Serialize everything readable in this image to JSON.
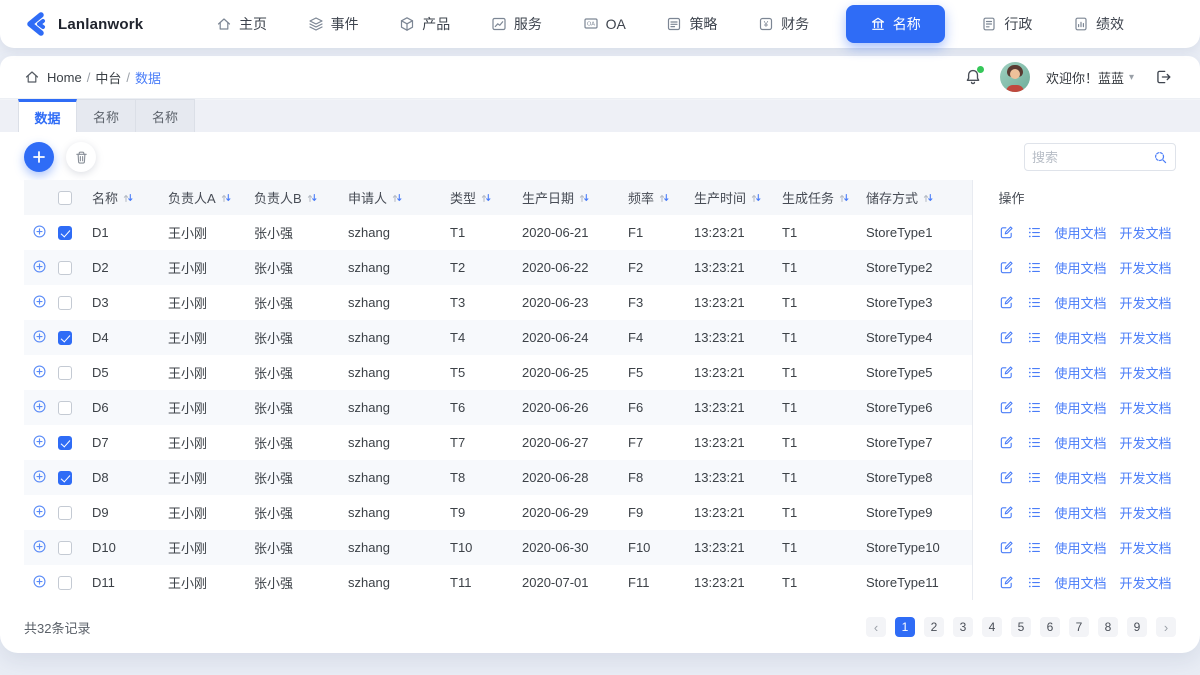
{
  "brand": {
    "name": "Lanlanwork"
  },
  "nav": {
    "items": [
      {
        "id": "home",
        "label": "主页",
        "icon": "home-icon",
        "active": false
      },
      {
        "id": "events",
        "label": "事件",
        "icon": "layers-icon",
        "active": false
      },
      {
        "id": "products",
        "label": "产品",
        "icon": "cube-icon",
        "active": false
      },
      {
        "id": "services",
        "label": "服务",
        "icon": "chart-line-icon",
        "active": false
      },
      {
        "id": "oa",
        "label": "OA",
        "icon": "monitor-icon",
        "active": false
      },
      {
        "id": "strategy",
        "label": "策略",
        "icon": "doc-lines-icon",
        "active": false
      },
      {
        "id": "finance",
        "label": "财务",
        "icon": "yuan-icon",
        "active": false
      },
      {
        "id": "names",
        "label": "名称",
        "icon": "bank-icon",
        "active": true
      },
      {
        "id": "admin",
        "label": "行政",
        "icon": "doc-admin-icon",
        "active": false
      },
      {
        "id": "performance",
        "label": "绩效",
        "icon": "doc-chart-icon",
        "active": false
      }
    ]
  },
  "subbar": {
    "breadcrumb": [
      "Home",
      "中台",
      "数据"
    ],
    "welcome": "欢迎你！蓝蓝"
  },
  "tabs": [
    {
      "label": "数据",
      "active": true
    },
    {
      "label": "名称",
      "active": false
    },
    {
      "label": "名称",
      "active": false
    }
  ],
  "toolbar": {
    "search_placeholder": "搜索"
  },
  "table": {
    "columns": [
      {
        "key": "name",
        "label": "名称",
        "sortable": true
      },
      {
        "key": "ownerA",
        "label": "负责人A",
        "sortable": true
      },
      {
        "key": "ownerB",
        "label": "负责人B",
        "sortable": true
      },
      {
        "key": "applicant",
        "label": "申请人",
        "sortable": true
      },
      {
        "key": "type",
        "label": "类型",
        "sortable": true
      },
      {
        "key": "prodDate",
        "label": "生产日期",
        "sortable": true
      },
      {
        "key": "freq",
        "label": "频率",
        "sortable": true
      },
      {
        "key": "prodTime",
        "label": "生产时间",
        "sortable": true
      },
      {
        "key": "genTask",
        "label": "生成任务",
        "sortable": true
      },
      {
        "key": "storeType",
        "label": "储存方式",
        "sortable": true
      }
    ],
    "action_column": {
      "label": "操作",
      "links": [
        "使用文档",
        "开发文档"
      ]
    },
    "rows": [
      {
        "checked": true,
        "name": "D1",
        "ownerA": "王小刚",
        "ownerB": "张小强",
        "applicant": "szhang",
        "type": "T1",
        "prodDate": "2020-06-21",
        "freq": "F1",
        "prodTime": "13:23:21",
        "genTask": "T1",
        "storeType": "StoreType1"
      },
      {
        "checked": false,
        "name": "D2",
        "ownerA": "王小刚",
        "ownerB": "张小强",
        "applicant": "szhang",
        "type": "T2",
        "prodDate": "2020-06-22",
        "freq": "F2",
        "prodTime": "13:23:21",
        "genTask": "T1",
        "storeType": "StoreType2"
      },
      {
        "checked": false,
        "name": "D3",
        "ownerA": "王小刚",
        "ownerB": "张小强",
        "applicant": "szhang",
        "type": "T3",
        "prodDate": "2020-06-23",
        "freq": "F3",
        "prodTime": "13:23:21",
        "genTask": "T1",
        "storeType": "StoreType3"
      },
      {
        "checked": true,
        "name": "D4",
        "ownerA": "王小刚",
        "ownerB": "张小强",
        "applicant": "szhang",
        "type": "T4",
        "prodDate": "2020-06-24",
        "freq": "F4",
        "prodTime": "13:23:21",
        "genTask": "T1",
        "storeType": "StoreType4"
      },
      {
        "checked": false,
        "name": "D5",
        "ownerA": "王小刚",
        "ownerB": "张小强",
        "applicant": "szhang",
        "type": "T5",
        "prodDate": "2020-06-25",
        "freq": "F5",
        "prodTime": "13:23:21",
        "genTask": "T1",
        "storeType": "StoreType5"
      },
      {
        "checked": false,
        "name": "D6",
        "ownerA": "王小刚",
        "ownerB": "张小强",
        "applicant": "szhang",
        "type": "T6",
        "prodDate": "2020-06-26",
        "freq": "F6",
        "prodTime": "13:23:21",
        "genTask": "T1",
        "storeType": "StoreType6"
      },
      {
        "checked": true,
        "name": "D7",
        "ownerA": "王小刚",
        "ownerB": "张小强",
        "applicant": "szhang",
        "type": "T7",
        "prodDate": "2020-06-27",
        "freq": "F7",
        "prodTime": "13:23:21",
        "genTask": "T1",
        "storeType": "StoreType7"
      },
      {
        "checked": true,
        "name": "D8",
        "ownerA": "王小刚",
        "ownerB": "张小强",
        "applicant": "szhang",
        "type": "T8",
        "prodDate": "2020-06-28",
        "freq": "F8",
        "prodTime": "13:23:21",
        "genTask": "T1",
        "storeType": "StoreType8"
      },
      {
        "checked": false,
        "name": "D9",
        "ownerA": "王小刚",
        "ownerB": "张小强",
        "applicant": "szhang",
        "type": "T9",
        "prodDate": "2020-06-29",
        "freq": "F9",
        "prodTime": "13:23:21",
        "genTask": "T1",
        "storeType": "StoreType9"
      },
      {
        "checked": false,
        "name": "D10",
        "ownerA": "王小刚",
        "ownerB": "张小强",
        "applicant": "szhang",
        "type": "T10",
        "prodDate": "2020-06-30",
        "freq": "F10",
        "prodTime": "13:23:21",
        "genTask": "T1",
        "storeType": "StoreType10"
      },
      {
        "checked": false,
        "name": "D11",
        "ownerA": "王小刚",
        "ownerB": "张小强",
        "applicant": "szhang",
        "type": "T11",
        "prodDate": "2020-07-01",
        "freq": "F11",
        "prodTime": "13:23:21",
        "genTask": "T1",
        "storeType": "StoreType11"
      }
    ]
  },
  "footer": {
    "total": "共32条记录",
    "pagination": {
      "prev": "‹",
      "next": "›",
      "pages": [
        "1",
        "2",
        "3",
        "4",
        "5",
        "6",
        "7",
        "8",
        "9"
      ],
      "active": "1"
    }
  },
  "colors": {
    "primary": "#2f6cf6",
    "link": "#4a7df8",
    "badge_green": "#35c759"
  }
}
